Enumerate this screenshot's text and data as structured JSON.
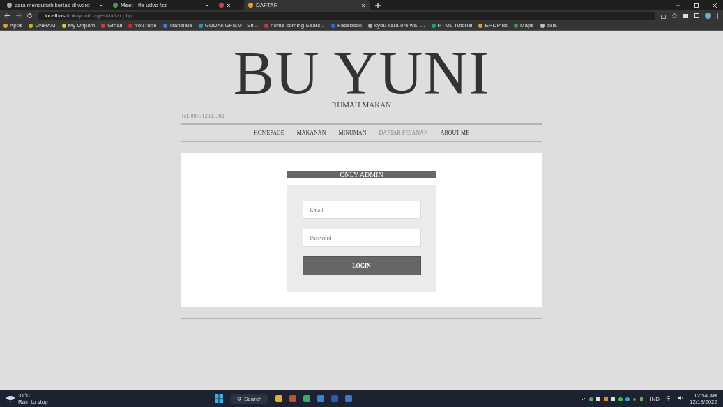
{
  "browser": {
    "tabs": [
      {
        "title": "cara mengubah kertas di word -",
        "selected": false
      },
      {
        "title": "Meet - ffe-udvc-fzz",
        "selected": false
      },
      {
        "selected": false
      },
      {
        "title": "DAFTAR",
        "selected": true
      }
    ],
    "address": {
      "host": "localhost",
      "path": "/tokoyuni/pages/daftar.php"
    },
    "bookmarks": [
      {
        "label": "Apps",
        "color": "#d9a520"
      },
      {
        "label": "UNRAM",
        "color": "#e0b000"
      },
      {
        "label": "My Unpam",
        "color": "#e8c020"
      },
      {
        "label": "Gmail",
        "color": "#d04030"
      },
      {
        "label": "YouTube",
        "color": "#e02020"
      },
      {
        "label": "Translate",
        "color": "#3a7be0"
      },
      {
        "label": "GUDANGFILM - Sit...",
        "color": "#1a9ad8"
      },
      {
        "label": "home coming Searc...",
        "color": "#d03a30"
      },
      {
        "label": "Facebook",
        "color": "#2a6ad8"
      },
      {
        "label": "kyou kara ore wa -...",
        "color": "#b0b0b0"
      },
      {
        "label": "HTML Tutorial",
        "color": "#2aa060"
      },
      {
        "label": "ERDPlus",
        "color": "#e0a020"
      },
      {
        "label": "Maps",
        "color": "#30a050"
      },
      {
        "label": "dola",
        "color": "#c0c0c0"
      }
    ]
  },
  "page": {
    "title": "BU YUNI",
    "subtitle": "RUMAH MAKAN",
    "phone": "Tel. 087712023302",
    "nav": [
      {
        "label": "HOMEPAGE",
        "selected": false
      },
      {
        "label": "MAKANAN",
        "selected": false
      },
      {
        "label": "MINUMAN",
        "selected": false
      },
      {
        "label": "DAFTAR PESANAN",
        "selected": true
      },
      {
        "label": "ABOUT ME",
        "selected": false
      }
    ],
    "login": {
      "heading": "ONLY ADMIN",
      "email": {
        "placeholder": "Email"
      },
      "password": {
        "placeholder": "Password"
      },
      "button": "LOGIN"
    }
  },
  "taskbar": {
    "weather": {
      "temperature": "31°C",
      "condition": "Rain to stop"
    },
    "search": "Search",
    "language": "IND",
    "time": "12:54 AM",
    "date": "12/18/2022"
  }
}
